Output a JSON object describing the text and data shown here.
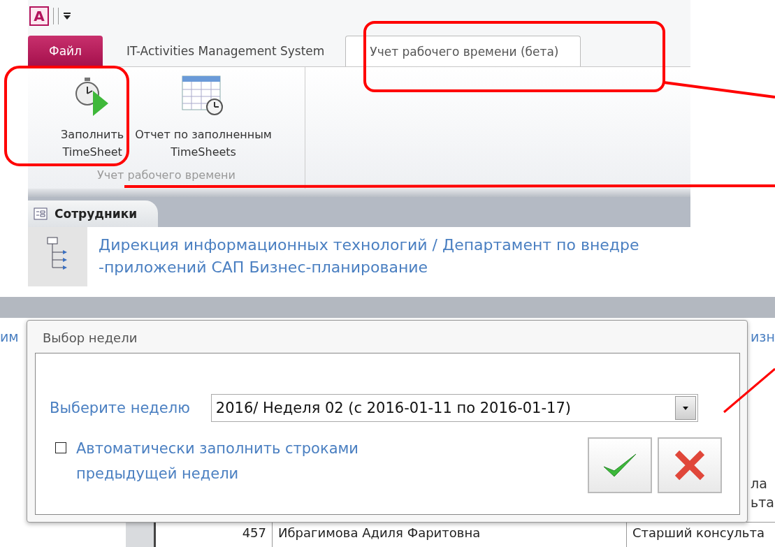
{
  "quick_access": {
    "app_icon": "A"
  },
  "ribbon_tabs": [
    {
      "label": "Файл",
      "kind": "file",
      "selected": false
    },
    {
      "label": "IT-Activities Management System",
      "kind": "normal",
      "selected": false
    },
    {
      "label": "Учет рабочего времени (бета)",
      "kind": "normal",
      "selected": true
    }
  ],
  "ribbon_buttons": [
    {
      "kind": "stopwatch",
      "lines": [
        "Заполнить",
        "TimeSheet"
      ]
    },
    {
      "kind": "calendar",
      "lines": [
        "Отчет по заполненным",
        "TimeSheets"
      ]
    }
  ],
  "ribbon_group": {
    "label": "Учет рабочего времени"
  },
  "document_tab": {
    "label": "Сотрудники"
  },
  "breadcrumb": {
    "lines": [
      "Дирекция информационных технологий / Департамент по внедре",
      "-приложений САП Бизнес-планирование"
    ]
  },
  "background": {
    "left_fragment": "им",
    "right_fragments": [
      "изн",
      "ла",
      "ьта"
    ],
    "table_row": {
      "number": "457",
      "name": "Ибрагимова Адиля Фаритовна",
      "position": "Старший консульта"
    }
  },
  "dialog": {
    "title": "Выбор недели",
    "week_label": "Выберите неделю",
    "week_value": "2016/ Неделя 02 (с 2016-01-11 по 2016-01-17)",
    "autofill": {
      "label": "Автоматически заполнить строками предыдущей недели",
      "checked": false
    },
    "buttons": [
      {
        "kind": "ok"
      },
      {
        "kind": "cancel"
      }
    ]
  }
}
